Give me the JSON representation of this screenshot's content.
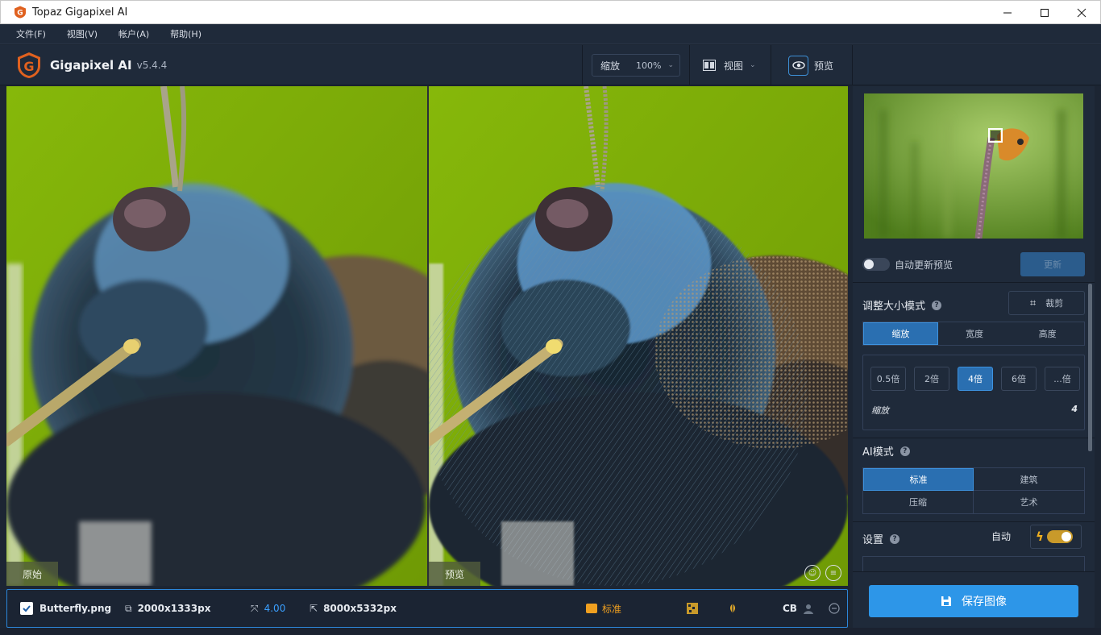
{
  "window": {
    "title": "Topaz Gigapixel AI"
  },
  "menu": [
    "文件(F)",
    "视图(V)",
    "帐户(A)",
    "帮助(H)"
  ],
  "brand": {
    "name": "Gigapixel AI",
    "version": "v5.4.4"
  },
  "toolbar": {
    "zoom_label": "缩放",
    "zoom_value": "100%",
    "view_label": "视图",
    "preview_label": "预览"
  },
  "viewer": {
    "left_label": "原始",
    "right_label": "预览"
  },
  "bottom": {
    "file_name": "Butterfly.png",
    "original_size": "2000x1333px",
    "scale": "4.00",
    "output_size": "8000x5332px",
    "ai_mode": "标准",
    "cb_label": "CB"
  },
  "panel": {
    "auto_update_label": "自动更新预览",
    "update_button": "更新",
    "resize_mode_title": "调整大小模式",
    "crop_button": "裁剪",
    "resize_tabs": [
      "缩放",
      "宽度",
      "高度"
    ],
    "scale_chips": [
      "0.5倍",
      "2倍",
      "4倍",
      "6倍",
      "...倍"
    ],
    "scale_label": "缩放",
    "scale_value": "4",
    "ai_mode_title": "AI模式",
    "ai_modes": [
      "标准",
      "建筑",
      "压缩",
      "艺术"
    ],
    "settings_title": "设置",
    "auto_label": "自动",
    "save_button": "保存图像"
  },
  "colors": {
    "accent": "#2d96e8",
    "active_tab": "#2a6fb1",
    "warning": "#f0a020",
    "background": "#1f2a3a"
  }
}
